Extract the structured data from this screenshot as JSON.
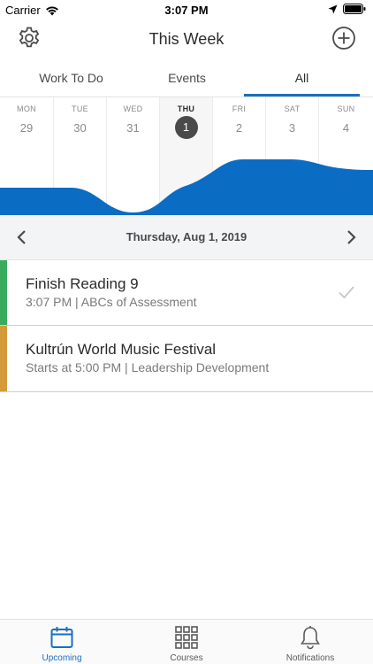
{
  "status": {
    "carrier": "Carrier",
    "time": "3:07 PM"
  },
  "nav": {
    "title": "This Week"
  },
  "tabs": [
    {
      "label": "Work To Do",
      "active": false
    },
    {
      "label": "Events",
      "active": false
    },
    {
      "label": "All",
      "active": true
    }
  ],
  "week": [
    {
      "name": "MON",
      "num": "29",
      "today": false
    },
    {
      "name": "TUE",
      "num": "30",
      "today": false
    },
    {
      "name": "WED",
      "num": "31",
      "today": false
    },
    {
      "name": "THU",
      "num": "1",
      "today": true
    },
    {
      "name": "FRI",
      "num": "2",
      "today": false
    },
    {
      "name": "SAT",
      "num": "3",
      "today": false
    },
    {
      "name": "SUN",
      "num": "4",
      "today": false
    }
  ],
  "date_bar": {
    "label": "Thursday, Aug 1, 2019"
  },
  "items": [
    {
      "title": "Finish Reading 9",
      "subtitle": "3:07 PM | ABCs of Assessment",
      "color": "#3aaa5c",
      "checked": true
    },
    {
      "title": "Kultrún World Music Festival",
      "subtitle": "Starts at 5:00 PM | Leadership Development",
      "color": "#d49a3a",
      "checked": false
    }
  ],
  "bottom_tabs": [
    {
      "label": "Upcoming",
      "icon": "calendar-icon",
      "active": true
    },
    {
      "label": "Courses",
      "icon": "grid-icon",
      "active": false
    },
    {
      "label": "Notifications",
      "icon": "bell-icon",
      "active": false
    }
  ],
  "colors": {
    "accent": "#1a6fbf",
    "wave": "#0b6cc4"
  }
}
